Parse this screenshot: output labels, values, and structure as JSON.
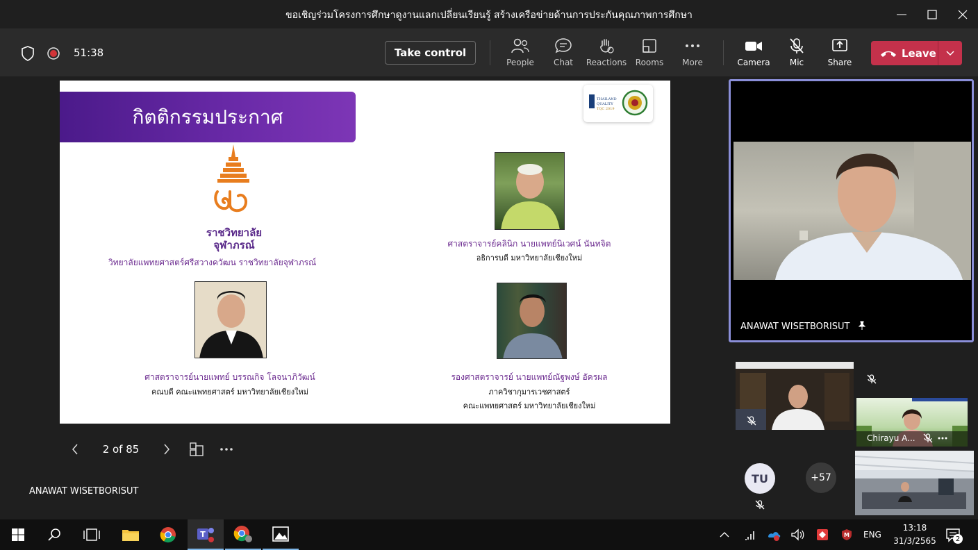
{
  "window": {
    "title": "ขอเชิญร่วมโครงการศึกษาดูงานแลกเปลี่ยนเรียนรู้ สร้างเครือข่ายด้านการประกันคุณภาพการศึกษา"
  },
  "toolbar": {
    "timer": "51:38",
    "take_control": "Take control",
    "people": "People",
    "chat": "Chat",
    "reactions": "Reactions",
    "rooms": "Rooms",
    "more": "More",
    "camera": "Camera",
    "mic": "Mic",
    "share": "Share",
    "leave": "Leave",
    "leave_color": "#c4314b"
  },
  "slide": {
    "banner_title": "กิตติกรรมประกาศ",
    "banner_color": "#5e239d",
    "logo_name": "ราชวิทยาลัย\nจุฬาภรณ์",
    "logo_caption": "วิทยาลัยแพทยศาสตร์ศรีสวางควัฒน ราชวิทยาลัยจุฬาภรณ์",
    "person1_name": "ศาสตราจารย์คลินิก นายแพทย์นิเวศน์ นันทจิต",
    "person1_title": "อธิการบดี มหาวิทยาลัยเชียงใหม่",
    "person2_name": "ศาสตราจารย์นายแพทย์ บรรณกิจ โลจนาภิวัฒน์",
    "person2_title": "คณบดี คณะแพทยศาสตร์ มหาวิทยาลัยเชียงใหม่",
    "person3_name": "รองศาสตราจารย์ นายแพทย์ณัฐพงษ์ อัครผล",
    "person3_title_1": "ภาควิชากุมารเวชศาสตร์",
    "person3_title_2": "คณะแพทยศาสตร์ มหาวิทยาลัยเชียงใหม่"
  },
  "slide_nav": {
    "page": "2 of 85"
  },
  "presenter_label": "ANAWAT WISETBORISUT",
  "main_video": {
    "name": "ANAWAT WISETBORISUT",
    "pinned": true
  },
  "participants": {
    "chirayu_name": "Chirayu A...",
    "tu_initials": "TU",
    "overflow_count": "+57"
  },
  "taskbar": {
    "language": "ENG",
    "time": "13:18",
    "date": "31/3/2565",
    "notifications": "2"
  }
}
